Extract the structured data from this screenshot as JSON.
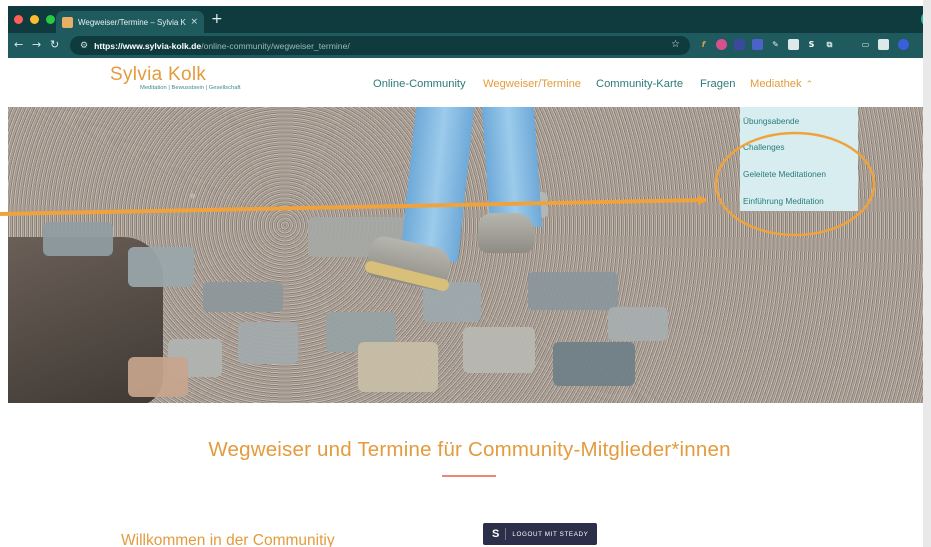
{
  "browser": {
    "tab_title": "Wegweiser/Termine – Sylvia K",
    "tab_close": "×",
    "new_tab": "+",
    "url_host": "https://www.sylvia-kolk.de",
    "url_path": "/online-community/wegweiser_termine/",
    "icons": [
      "back-icon",
      "forward-icon",
      "reload-icon",
      "site-info-icon",
      "bookmark-star-icon"
    ]
  },
  "site": {
    "logo_name": "Sylvia Kolk",
    "logo_tagline": "Meditation | Bewusstsein | Gesellschaft",
    "nav": [
      {
        "label": "Online-Community"
      },
      {
        "label": "Wegweiser/Termine"
      },
      {
        "label": "Community-Karte"
      },
      {
        "label": "Fragen"
      },
      {
        "label": "Mediathek"
      }
    ],
    "dropdown": [
      {
        "label": "Übungsabende"
      },
      {
        "label": "Challenges"
      },
      {
        "label": "Geleitete Meditationen"
      },
      {
        "label": "Einführung Meditation"
      }
    ]
  },
  "content": {
    "headline": "Wegweiser und Termine für Community-Mitglieder*innen",
    "welcome": "Willkommen in der Communitiy",
    "steady_logo": "S",
    "steady_label": "LOGOUT MIT STEADY"
  },
  "colors": {
    "accent_orange": "#e39b3d",
    "teal": "#2b7b7a",
    "browser_dark": "#0f3b3e",
    "dropdown_bg": "#d7edf0"
  }
}
